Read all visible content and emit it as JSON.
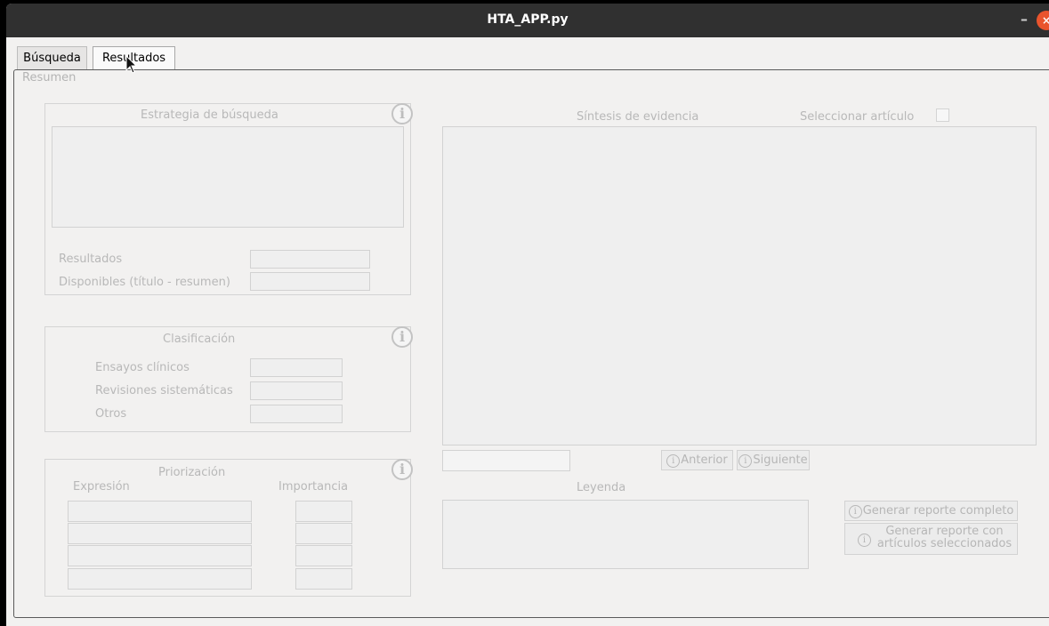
{
  "window": {
    "title": "HTA_APP.py",
    "minimize": "–",
    "close": "×"
  },
  "tabs": [
    "Búsqueda",
    "Resultados"
  ],
  "group_label": "Resumen",
  "strategy": {
    "title": "Estrategia de búsqueda",
    "resultados_label": "Resultados",
    "disponibles_label": "Disponibles (título - resumen)"
  },
  "classification": {
    "title": "Clasificación",
    "ensayos_label": "Ensayos clínicos",
    "revisiones_label": "Revisiones sistemáticas",
    "otros_label": "Otros"
  },
  "prioritization": {
    "title": "Priorización",
    "expresion_label": "Expresión",
    "importancia_label": "Importancia"
  },
  "evidence": {
    "title": "Síntesis de evidencia",
    "select_label": "Seleccionar artículo"
  },
  "navigation": {
    "anterior": "Anterior",
    "siguiente": "Siguiente"
  },
  "legend_label": "Leyenda",
  "reports": {
    "full": "Generar reporte completo",
    "selected_line1": "Generar reporte con",
    "selected_line2": "artículos seleccionados"
  },
  "info_glyph": "i"
}
